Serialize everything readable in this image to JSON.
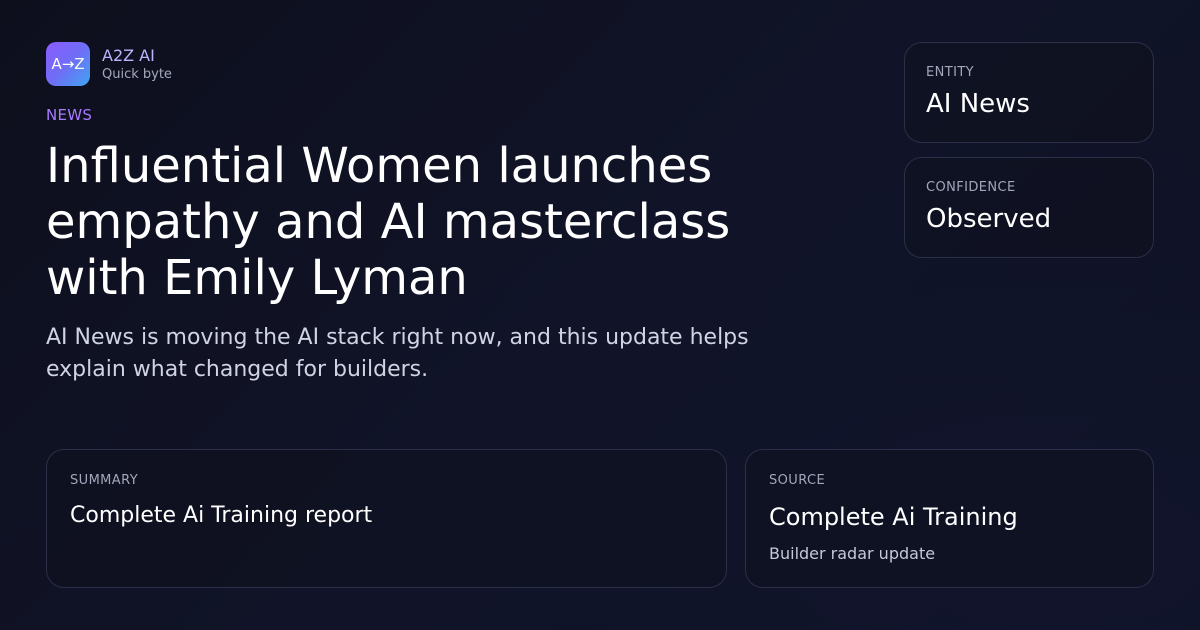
{
  "brand": {
    "logo_text": "A→Z",
    "name": "A2Z AI",
    "tagline": "Quick byte"
  },
  "article": {
    "category": "NEWS",
    "headline": "Influential Women launches empathy and AI masterclass with Emily Lyman",
    "subtitle": "AI News is moving the AI stack right now, and this update helps explain what changed for builders."
  },
  "entity": {
    "label": "ENTITY",
    "value": "AI News"
  },
  "confidence": {
    "label": "CONFIDENCE",
    "value": "Observed"
  },
  "summary": {
    "label": "SUMMARY",
    "value": "Complete Ai Training report"
  },
  "source": {
    "label": "SOURCE",
    "value": "Complete Ai Training",
    "detail": "Builder radar update"
  },
  "colors": {
    "accent_purple": "#a87bff",
    "brand_name": "#b9b5ff",
    "background": "#0f1224"
  }
}
